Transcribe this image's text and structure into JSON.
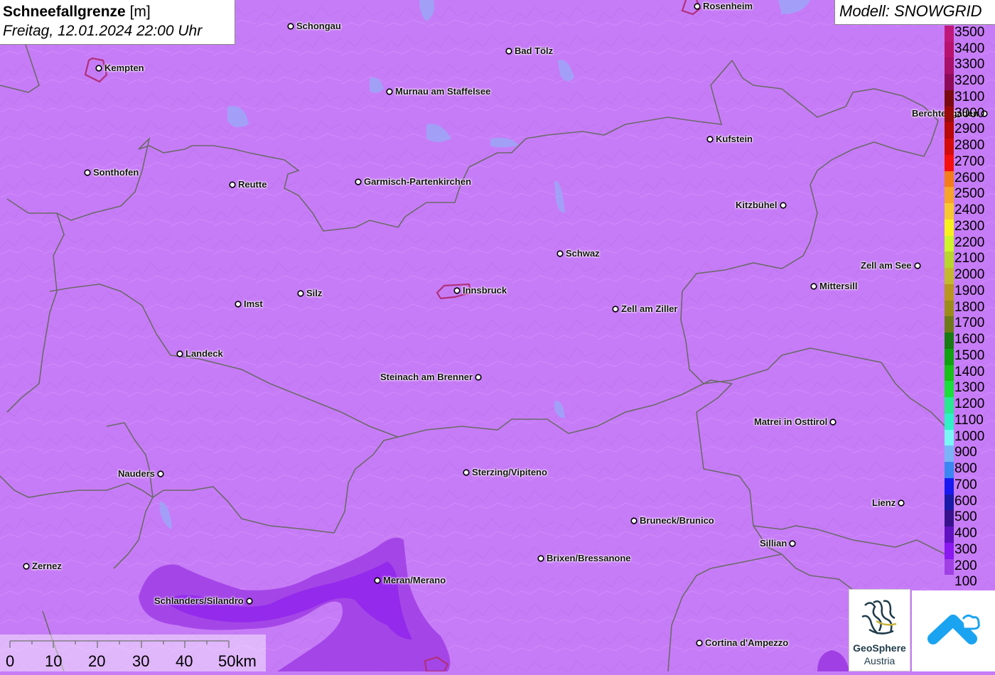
{
  "title": {
    "main": "Schneefallgrenze",
    "unit": "[m]",
    "datetime": "Freitag, 12.01.2024 22:00 Uhr"
  },
  "model": "Modell: SNOWGRID",
  "legend": [
    {
      "label": "3500",
      "color": "#c0187a"
    },
    {
      "label": "3400",
      "color": "#b8126f"
    },
    {
      "label": "3300",
      "color": "#a8106a"
    },
    {
      "label": "3200",
      "color": "#8e0b5a"
    },
    {
      "label": "3100",
      "color": "#7a0a10"
    },
    {
      "label": "3000",
      "color": "#990a0a"
    },
    {
      "label": "2900",
      "color": "#b80808"
    },
    {
      "label": "2800",
      "color": "#d40b0b"
    },
    {
      "label": "2700",
      "color": "#f51010"
    },
    {
      "label": "2600",
      "color": "#f47c1a"
    },
    {
      "label": "2500",
      "color": "#f7a42a"
    },
    {
      "label": "2400",
      "color": "#f8c830"
    },
    {
      "label": "2300",
      "color": "#f9f21a"
    },
    {
      "label": "2200",
      "color": "#cef52a"
    },
    {
      "label": "2100",
      "color": "#b8d62c"
    },
    {
      "label": "2000",
      "color": "#c4b92e"
    },
    {
      "label": "1900",
      "color": "#b89620"
    },
    {
      "label": "1800",
      "color": "#9b8c1a"
    },
    {
      "label": "1700",
      "color": "#6e7a1a"
    },
    {
      "label": "1600",
      "color": "#187a12"
    },
    {
      "label": "1500",
      "color": "#10a010"
    },
    {
      "label": "1400",
      "color": "#18c018"
    },
    {
      "label": "1300",
      "color": "#1ade3a"
    },
    {
      "label": "1200",
      "color": "#28e890"
    },
    {
      "label": "1100",
      "color": "#30f0c8"
    },
    {
      "label": "1000",
      "color": "#7af6f6"
    },
    {
      "label": "900",
      "color": "#7ab4f6"
    },
    {
      "label": "800",
      "color": "#3a86f2"
    },
    {
      "label": "700",
      "color": "#1818f0"
    },
    {
      "label": "600",
      "color": "#1a1aa8"
    },
    {
      "label": "500",
      "color": "#38128c"
    },
    {
      "label": "400",
      "color": "#6012c0"
    },
    {
      "label": "300",
      "color": "#8a18f0"
    },
    {
      "label": "200",
      "color": "#a040e4"
    },
    {
      "label": "100",
      "color": "#c77cf7"
    }
  ],
  "cities": [
    {
      "name": "Rosenheim",
      "dot": "left"
    },
    {
      "name": "Schongau",
      "dot": "left"
    },
    {
      "name": "Bad Tölz",
      "dot": "left"
    },
    {
      "name": "Kempten",
      "dot": "left"
    },
    {
      "name": "Murnau am Staffelsee",
      "dot": "left"
    },
    {
      "name": "Berchtesgaden",
      "dot": "right"
    },
    {
      "name": "Kufstein",
      "dot": "left"
    },
    {
      "name": "Sonthofen",
      "dot": "left"
    },
    {
      "name": "Reutte",
      "dot": "left"
    },
    {
      "name": "Garmisch-Partenkirchen",
      "dot": "left"
    },
    {
      "name": "Kitzbühel",
      "dot": "right"
    },
    {
      "name": "Schwaz",
      "dot": "left"
    },
    {
      "name": "Zell am See",
      "dot": "right"
    },
    {
      "name": "Mittersill",
      "dot": "left"
    },
    {
      "name": "Silz",
      "dot": "left"
    },
    {
      "name": "Innsbruck",
      "dot": "left"
    },
    {
      "name": "Imst",
      "dot": "left"
    },
    {
      "name": "Zell am Ziller",
      "dot": "left"
    },
    {
      "name": "Landeck",
      "dot": "left"
    },
    {
      "name": "Steinach am Brenner",
      "dot": "right"
    },
    {
      "name": "Matrei in Osttirol",
      "dot": "right"
    },
    {
      "name": "Nauders",
      "dot": "right"
    },
    {
      "name": "Sterzing/Vipiteno",
      "dot": "left"
    },
    {
      "name": "Lienz",
      "dot": "right"
    },
    {
      "name": "Bruneck/Brunico",
      "dot": "left"
    },
    {
      "name": "Sillian",
      "dot": "right"
    },
    {
      "name": "Zernez",
      "dot": "left"
    },
    {
      "name": "Brixen/Bressanone",
      "dot": "left"
    },
    {
      "name": "Meran/Merano",
      "dot": "left"
    },
    {
      "name": "Schlanders/Silandro",
      "dot": "right"
    },
    {
      "name": "Cortina d'Ampezzo",
      "dot": "left"
    }
  ],
  "scale": [
    "0",
    "10",
    "20",
    "30",
    "40",
    "50km"
  ],
  "logos": {
    "geosphere_line1": "GeoSphere",
    "geosphere_line2": "Austria"
  }
}
